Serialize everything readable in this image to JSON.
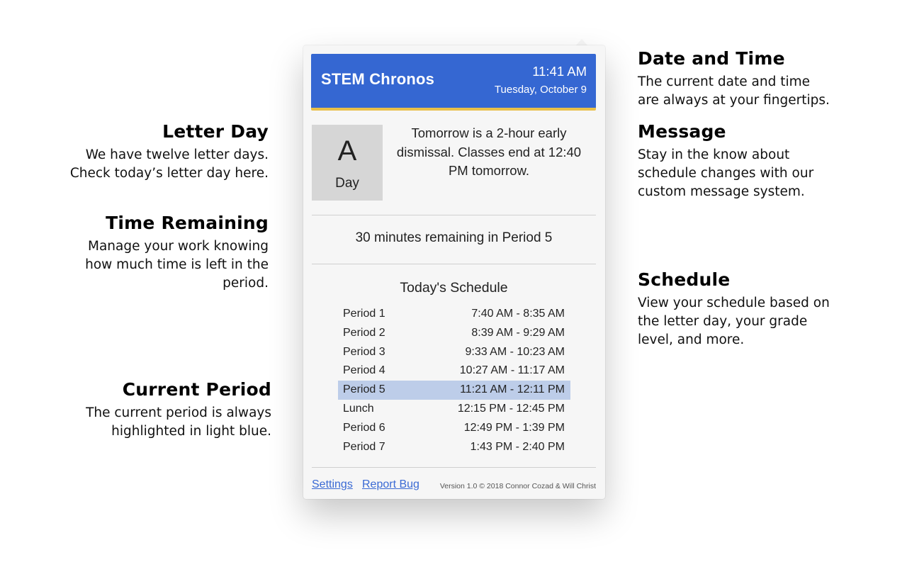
{
  "annotations": {
    "letter_day": {
      "title": "Letter Day",
      "lines": [
        "We have twelve letter days.",
        "Check today’s letter day here."
      ]
    },
    "time_remaining": {
      "title": "Time Remaining",
      "lines": [
        "Manage your work knowing",
        "how much time is left in the",
        "period."
      ]
    },
    "current_period": {
      "title": "Current Period",
      "lines": [
        "The current period is always",
        "highlighted in light blue."
      ]
    },
    "date_time": {
      "title": "Date and Time",
      "lines": [
        "The current date and time",
        "are always at your fingertips."
      ]
    },
    "message": {
      "title": "Message",
      "lines": [
        "Stay in the know about",
        "schedule changes with our",
        "custom message system."
      ]
    },
    "schedule": {
      "title": "Schedule",
      "lines": [
        "View your schedule based on",
        "the letter day, your grade",
        "level, and more."
      ]
    }
  },
  "popover": {
    "header": {
      "app_title": "STEM Chronos",
      "time": "11:41 AM",
      "date": "Tuesday, October 9",
      "accent_color": "#3567d2",
      "stripe_color": "#e9c04a"
    },
    "letter_day": {
      "letter": "A",
      "label": "Day"
    },
    "message": "Tomorrow is a 2-hour early dismissal. Classes end at 12:40 PM tomorrow.",
    "remaining": "30 minutes remaining in Period 5",
    "schedule": {
      "title": "Today's Schedule",
      "highlight_color": "#bdcde9",
      "rows": [
        {
          "period": "Period 1",
          "time": "7:40 AM - 8:35 AM",
          "current": false
        },
        {
          "period": "Period 2",
          "time": "8:39 AM - 9:29 AM",
          "current": false
        },
        {
          "period": "Period 3",
          "time": "9:33 AM - 10:23 AM",
          "current": false
        },
        {
          "period": "Period 4",
          "time": "10:27 AM - 11:17 AM",
          "current": false
        },
        {
          "period": "Period 5",
          "time": "11:21 AM - 12:11 PM",
          "current": true
        },
        {
          "period": "Lunch",
          "time": "12:15 PM - 12:45 PM",
          "current": false
        },
        {
          "period": "Period 6",
          "time": "12:49 PM - 1:39 PM",
          "current": false
        },
        {
          "period": "Period 7",
          "time": "1:43 PM - 2:40 PM",
          "current": false
        }
      ]
    },
    "footer": {
      "settings_label": "Settings",
      "report_bug_label": "Report Bug",
      "version": "Version 1.0 © 2018 Connor Cozad & Will Christ"
    }
  }
}
